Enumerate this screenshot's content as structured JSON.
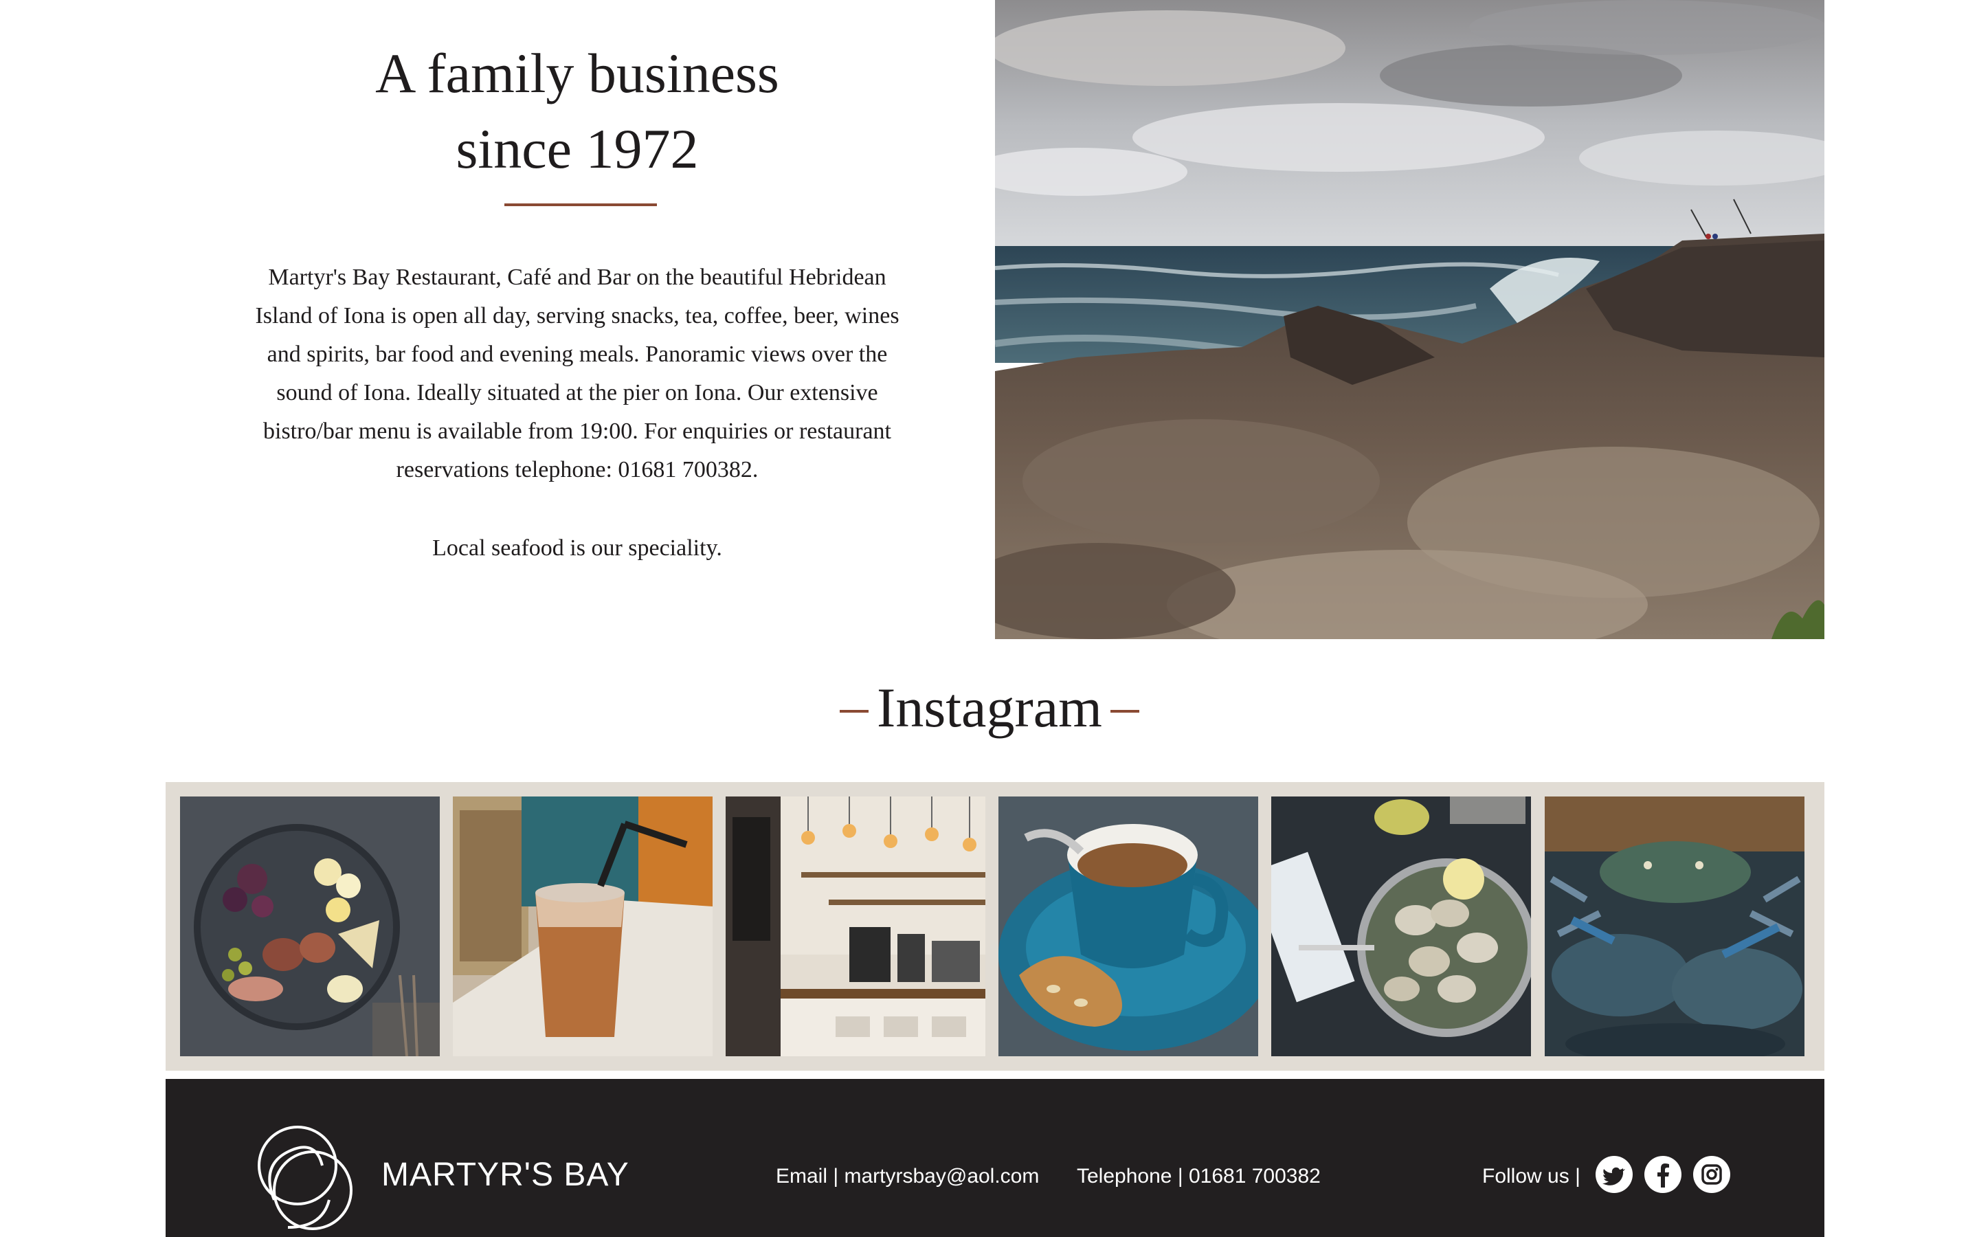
{
  "about": {
    "title_line1": "A family business",
    "title_line2": "since 1972",
    "body_lines": [
      "Martyr's Bay Restaurant, Café and Bar on the beautiful Hebridean",
      "Island of Iona is open all day, serving snacks, tea, coffee, beer, wines",
      "and spirits, bar food and evening meals. Panoramic views over the",
      "sound of Iona. Ideally situated at the pier on Iona. Our extensive",
      "bistro/bar menu is available from 19:00. For enquiries or restaurant",
      "reservations telephone: 01681 700382."
    ],
    "tagline": "Local seafood is our speciality."
  },
  "instagram": {
    "title": "Instagram",
    "posts": [
      "cheese-and-fruit-platter",
      "iced-coffee",
      "cafe-counter",
      "espresso-and-biscotti",
      "clams-in-pan",
      "blue-crabs"
    ]
  },
  "footer": {
    "brand": "MARTYR'S BAY",
    "email_label": "Email",
    "email": "martyrsbay@aol.com",
    "phone_label": "Telephone",
    "phone": "01681 700382",
    "follow_label": "Follow us",
    "social": [
      "twitter-icon",
      "facebook-icon",
      "instagram-icon"
    ]
  },
  "colors": {
    "accent": "#8a4a33",
    "footer_bg": "#221f20",
    "strip_bg": "#e1dcd4",
    "text": "#1f1c1d"
  }
}
